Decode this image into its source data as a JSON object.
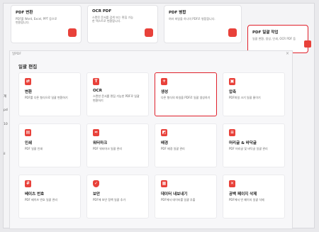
{
  "top_cards": [
    {
      "title": "PDF 변환",
      "desc": "PDF를 Word, Excel, PPT 등으로 변환합니다."
    },
    {
      "title": "OCR PDF",
      "desc": "스캔된 문서를 검색 또는 편집 가능한 텍스트로 변환합니다."
    },
    {
      "title": "PDF 병합",
      "desc": "여러 파일을 하나의 PDF로 병합합니다."
    },
    {
      "title": "PDF 일괄 작업",
      "desc": "일괄 변환, 생성, 인쇄, OCR PDF 등"
    }
  ],
  "side_fragments": [
    "계",
    "pd",
    "10",
    "il"
  ],
  "panel": {
    "window_title": "일PDF",
    "close": "×",
    "section_title": "일괄 편집"
  },
  "cards": [
    {
      "title": "변환",
      "desc": "PDF를 다른 형식으로 일괄 변환하기"
    },
    {
      "title": "OCR",
      "desc": "스캔한 문서를 편집 가능한 PDF로 일괄 변환하기"
    },
    {
      "title": "생성",
      "desc": "다른 형식의 파일을 PDF로 일괄 생성하기"
    },
    {
      "title": "압축",
      "desc": "PDF파일 크기 일괄 줄이기"
    },
    {
      "title": "인쇄",
      "desc": "PDF 일괄 인쇄"
    },
    {
      "title": "워터마크",
      "desc": "PDF 워터마크 일괄 관리"
    },
    {
      "title": "배경",
      "desc": "PDF 배경 일괄 관리"
    },
    {
      "title": "머리글 & 바닥글",
      "desc": "PDF 머리글 및 바닥글 일괄 관리"
    },
    {
      "title": "베이츠 번호",
      "desc": "PDF 베이츠 번호 일괄 관리"
    },
    {
      "title": "보안",
      "desc": "PDF에 보안 정책 일괄 추가"
    },
    {
      "title": "데이터 내보내기",
      "desc": "PDF에서 데이터를 일괄 추출"
    },
    {
      "title": "공백 페이지 삭제",
      "desc": "PDF에서 빈 페이지 일괄 삭제"
    }
  ],
  "colors": {
    "accent": "#e8413a",
    "highlight": "#e0202b"
  },
  "icons": [
    "convert-icon",
    "ocr-icon",
    "create-icon",
    "compress-icon",
    "print-icon",
    "watermark-icon",
    "background-icon",
    "header-footer-icon",
    "bates-icon",
    "security-icon",
    "export-data-icon",
    "delete-blank-icon"
  ]
}
